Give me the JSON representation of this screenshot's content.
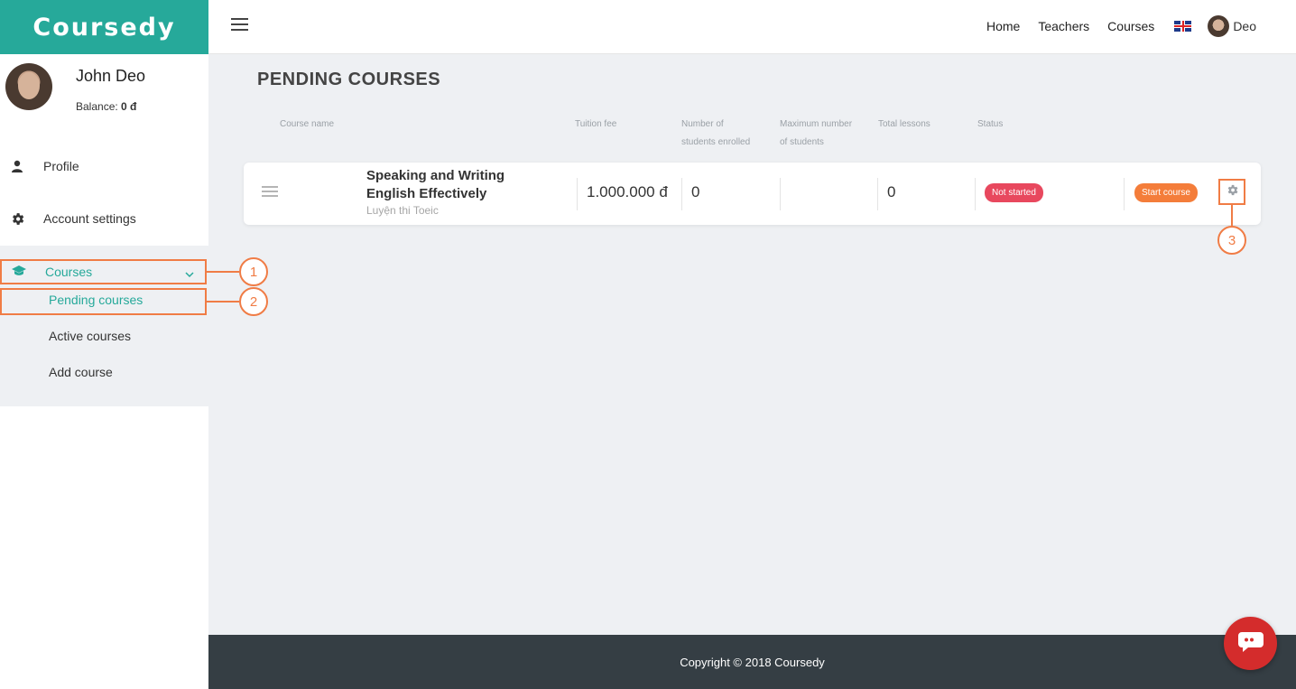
{
  "app": {
    "logo": "Coursedy",
    "brand_color": "#26a99a",
    "accent_color": "#f07c45"
  },
  "user": {
    "name": "John Deo",
    "balance_label": "Balance:",
    "balance_value": "0 đ",
    "short_name": "Deo"
  },
  "sidebar": {
    "items": [
      {
        "label": "Profile",
        "icon": "person-icon"
      },
      {
        "label": "Account settings",
        "icon": "gear-icon"
      }
    ],
    "courses": {
      "label": "Courses",
      "icon": "graduation-cap-icon",
      "sub_items": [
        "Pending courses",
        "Active courses",
        "Add course"
      ]
    }
  },
  "topnav": {
    "links": [
      "Home",
      "Teachers",
      "Courses"
    ],
    "language_icon": "uk-flag-icon"
  },
  "callouts": [
    "1",
    "2",
    "3"
  ],
  "main": {
    "title": "PENDING COURSES",
    "columns": {
      "course_name": "Course name",
      "tuition": "Tuition fee",
      "enrolled_1": "Number of",
      "enrolled_2": "students enrolled",
      "max_1": "Maximum number",
      "max_2": "of students",
      "lessons": "Total lessons",
      "status": "Status"
    },
    "rows": [
      {
        "name_line1": "Speaking and Writing",
        "name_line2": "English Effectively",
        "category": "Luyện thi Toeic",
        "tuition": "1.000.000 đ",
        "enrolled": "0",
        "max_students": "",
        "lessons": "0",
        "status": "Not started",
        "action": "Start course"
      }
    ]
  },
  "footer": {
    "copyright": "Copyright © 2018 Coursedy"
  }
}
